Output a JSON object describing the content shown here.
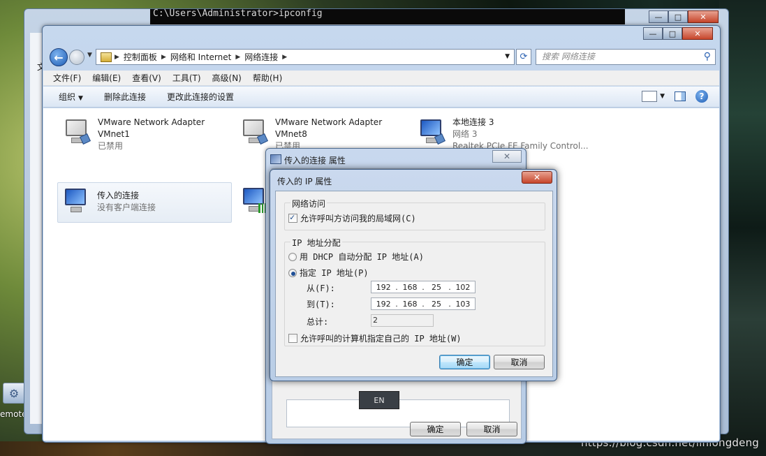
{
  "console": {
    "text": "C:\\Users\\Administrator>ipconfig",
    "controls": {
      "min": "—",
      "max": "□",
      "close": "✕"
    }
  },
  "desktop": {
    "icon_label": "emote",
    "watermark": "https://blog.csdn.net/linlongdeng"
  },
  "explorer": {
    "controls": {
      "min": "—",
      "max": "□",
      "close": "✕"
    },
    "address": {
      "crumbs": [
        "控制面板",
        "网络和 Internet",
        "网络连接"
      ]
    },
    "search_placeholder": "搜索 网络连接",
    "menu": [
      "文件(F)",
      "编辑(E)",
      "查看(V)",
      "工具(T)",
      "高级(N)",
      "帮助(H)"
    ],
    "commands": {
      "organize": "组织",
      "delete": "删除此连接",
      "change": "更改此连接的设置"
    },
    "items": [
      {
        "name": "VMware Network Adapter",
        "line2": "VMnet1",
        "status": "已禁用"
      },
      {
        "name": "VMware Network Adapter",
        "line2": "VMnet8",
        "status": "已禁用"
      },
      {
        "name": "本地连接 3",
        "line2": "网络  3",
        "status": "Realtek PCIe FE Family Control..."
      },
      {
        "name": "传入的连接",
        "line2": "没有客户端连接"
      }
    ],
    "left_strip": {
      "char": "文",
      "bullet": "•"
    }
  },
  "props_dialog": {
    "title": "传入的连接 属性",
    "close": "✕",
    "lang": "EN",
    "ok": "确定",
    "cancel": "取消"
  },
  "ip_dialog": {
    "title": "传入的 IP 属性",
    "close": "✕",
    "net_access": {
      "title": "网络访问",
      "allow_lan": "允许呼叫方访问我的局域网(C)",
      "allow_lan_checked": true
    },
    "ip_assign": {
      "title": "IP 地址分配",
      "dhcp": "用 DHCP 自动分配 IP 地址(A)",
      "specify": "指定 IP 地址(P)",
      "from_label": "从(F):",
      "to_label": "到(T):",
      "total_label": "总计:",
      "from": [
        "192",
        "168",
        "25",
        "102"
      ],
      "to": [
        "192",
        "168",
        "25",
        "103"
      ],
      "total": "2",
      "allow_own": "允许呼叫的计算机指定自己的 IP 地址(W)",
      "allow_own_checked": false,
      "selected": "specify"
    },
    "ok": "确定",
    "cancel": "取消"
  }
}
